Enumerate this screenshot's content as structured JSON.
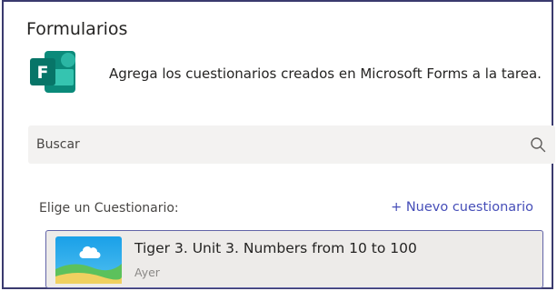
{
  "panel": {
    "title": "Formularios",
    "intro": "Agrega los cuestionarios creados en Microsoft Forms a la tarea.",
    "logo_letter": "F"
  },
  "search": {
    "placeholder": "Buscar",
    "value": ""
  },
  "list": {
    "label": "Elige un Cuestionario:",
    "new_quiz": "+ Nuevo cuestionario",
    "items": [
      {
        "title": "Tiger 3. Unit 3. Numbers from 10 to 100",
        "date": "Ayer",
        "icon": "cloud-landscape-icon"
      }
    ]
  },
  "colors": {
    "accent": "#464eb8",
    "forms_green": "#077568",
    "card_bg": "#edebe9",
    "search_bg": "#f3f2f1"
  }
}
